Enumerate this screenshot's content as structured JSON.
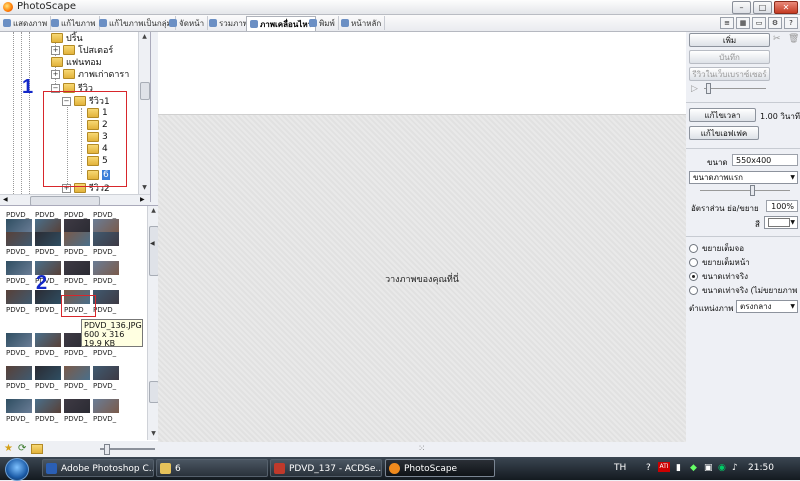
{
  "window": {
    "title": "PhotoScape"
  },
  "tabs": [
    {
      "label": "แสดงภาพ",
      "active": false
    },
    {
      "label": "แก้ไขภาพ",
      "active": false
    },
    {
      "label": "แก้ไขภาพเป็นกลุ่ม",
      "active": false
    },
    {
      "label": "จัดหน้า",
      "active": false
    },
    {
      "label": "รวมภาพ",
      "active": false
    },
    {
      "label": "ภาพเคลื่อนไหว",
      "active": true
    },
    {
      "label": "พิมพ์",
      "active": false
    },
    {
      "label": "หน้าหลัก",
      "active": false
    }
  ],
  "tree": {
    "items": [
      {
        "label": "ปริ้น"
      },
      {
        "label": "โปสเตอร์"
      },
      {
        "label": "แฟนทอม"
      },
      {
        "label": "ภาพเก่าดารา"
      },
      {
        "label": "รีวิว"
      },
      {
        "label": "รีวิว1"
      },
      {
        "label": "1"
      },
      {
        "label": "2"
      },
      {
        "label": "3"
      },
      {
        "label": "4"
      },
      {
        "label": "5"
      },
      {
        "label": "6",
        "selected": true
      },
      {
        "label": "รีวิว2"
      }
    ]
  },
  "annotations": {
    "marker1": "1",
    "marker2": "2"
  },
  "thumbnails": {
    "label": "PDVD_..."
  },
  "tooltip": {
    "filename": "PDVD_136.JPG",
    "dimensions": "600 x 316",
    "size": "19.9 KB"
  },
  "canvas": {
    "placeholder": "วางภาพของคุณที่นี่"
  },
  "right_panel": {
    "add_button": "เพิ่ม",
    "save_button": "บันทึก",
    "preview_button": "รีวิวในเว็บเบราซ์เซอร์",
    "change_time_button": "แก้ไขเวลา",
    "time_value": "1.00 วินาที",
    "change_effect_button": "แก้ไขเอฟเฟค",
    "size_label": "ขนาด",
    "size_value": "550x400",
    "size_mode_select": "ขนาดภาพแรก",
    "ratio_label": "อัตราส่วน ย่อ/ขยาย",
    "ratio_value": "100%",
    "color_label": "สี",
    "radio_fit_screen": "ขยายเต็มจอ",
    "radio_fit_page": "ขยายเต็มหน้า",
    "radio_actual": "ขนาดเท่าจริง",
    "radio_actual_no_zoom": "ขนาดเท่าจริง (ไม่ขยายภาพ",
    "position_label": "ตำแหน่งภาพ",
    "position_value": "ตรงกลาง"
  },
  "taskbar": {
    "tasks": [
      {
        "label": "Adobe Photoshop C...",
        "color": "#2b5fb5"
      },
      {
        "label": "6",
        "color": "#e6c25a"
      },
      {
        "label": "PDVD_137 - ACDSe...",
        "color": "#c0392b"
      },
      {
        "label": "PhotoScape",
        "color": "#f08a1d",
        "active": true
      }
    ],
    "language": "TH",
    "clock": "21:50"
  }
}
